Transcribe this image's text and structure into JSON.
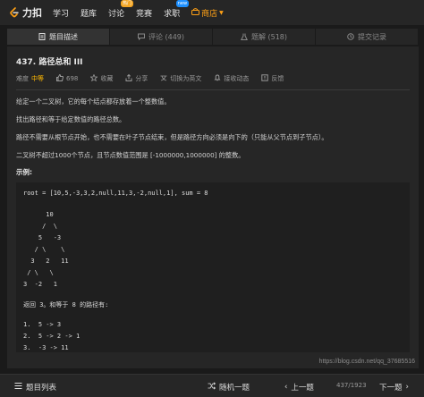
{
  "nav": {
    "logo_text": "力扣",
    "items": [
      {
        "label": "学习"
      },
      {
        "label": "题库"
      },
      {
        "label": "讨论",
        "badge": "热门"
      },
      {
        "label": "竞赛"
      },
      {
        "label": "求职",
        "badge": "new"
      },
      {
        "label": "商店"
      }
    ],
    "accent": "#ffa116"
  },
  "tabs": [
    {
      "label": "题目描述",
      "icon": "document-icon",
      "active": true
    },
    {
      "label": "评论 (449)",
      "icon": "comment-icon"
    },
    {
      "label": "题解 (518)",
      "icon": "flask-icon"
    },
    {
      "label": "提交记录",
      "icon": "history-icon"
    }
  ],
  "problem": {
    "title": "437. 路径总和 III",
    "difficulty_label": "难度",
    "difficulty": "中等",
    "likes": "698",
    "favorite": "收藏",
    "share": "分享",
    "switch_lang": "切换为英文",
    "subscribe": "接收动态",
    "feedback": "反馈",
    "paragraphs": [
      "给定一个二叉树，它的每个结点都存放着一个整数值。",
      "找出路径和等于给定数值的路径总数。",
      "路径不需要从根节点开始，也不需要在叶子节点结束，但是路径方向必须是向下的（只能从父节点到子节点）。",
      "二叉树不超过1000个节点，且节点数值范围是 [-1000000,1000000] 的整数。"
    ],
    "examples_label": "示例:",
    "code": [
      "root = [10,5,-3,3,2,null,11,3,-2,null,1], sum = 8",
      "      10",
      "     /  \\",
      "    5   -3",
      "   / \\    \\",
      "  3   2   11",
      " / \\   \\",
      "3  -2   1",
      "返回 3。和等于 8 的路径有:",
      "1.  5 -> 3",
      "2.  5 -> 2 -> 1",
      "3.  -3 -> 11"
    ]
  },
  "watermark": "https://blog.csdn.net/qq_37685516",
  "bottom": {
    "list_label": "题目列表",
    "random_label": "随机一题",
    "prev_label": "上一题",
    "counter": "437/1923",
    "next_label": "下一题"
  }
}
